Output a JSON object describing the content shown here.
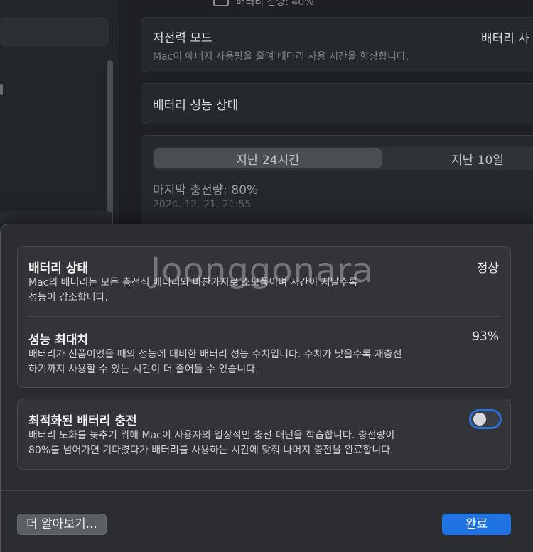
{
  "background": {
    "top_cut_text": "배터리 잔량: 40%",
    "low_power": {
      "title": "저전력 모드",
      "description": "Mac이 에너지 사용량을 줄여 배터리 사용 시간을 향상합니다.",
      "value": "배터리 사"
    },
    "performance_row": {
      "title": "배터리 성능 상태"
    },
    "chart_panel": {
      "tab_active": "지난 24시간",
      "tab_inactive": "지난 10일",
      "last_charge": "마지막 충전량: 80%",
      "timestamp": "2024. 12. 21. 21:55"
    }
  },
  "sheet": {
    "battery_status": {
      "title": "배터리 상태",
      "value": "정상",
      "description_line1": "Mac의 배터리는 모든 충전식 배터리와 마찬가지로 소모품이며 시간이 지날수록",
      "description_line2": "성능이 감소합니다."
    },
    "max_capacity": {
      "title": "성능 최대치",
      "value": "93%",
      "description_line1": "배터리가 신품이었을 때의 성능에 대비한 배터리 성능 수치입니다. 수치가 낮을수록 재충전",
      "description_line2": "하기까지 사용할 수 있는 시간이 더 줄어들 수 있습니다."
    },
    "optimized_charging": {
      "title": "최적화된 배터리 충전",
      "enabled": false,
      "description_line1": "배터리 노화를 늦추기 위해 Mac이 사용자의 일상적인 충전 패턴을 학습합니다. 충전량이",
      "description_line2": "80%를 넘어가면 기다렸다가 배터리를 사용하는 시간에 맞춰 나머지 충전을 완료합니다."
    },
    "learn_more_button": "더 알아보기...",
    "done_button": "완료"
  },
  "watermark": "Joonggonara",
  "colors": {
    "accent": "#1f73e3",
    "sheet_bg": "#2b2d31",
    "group_bg": "#323438"
  }
}
